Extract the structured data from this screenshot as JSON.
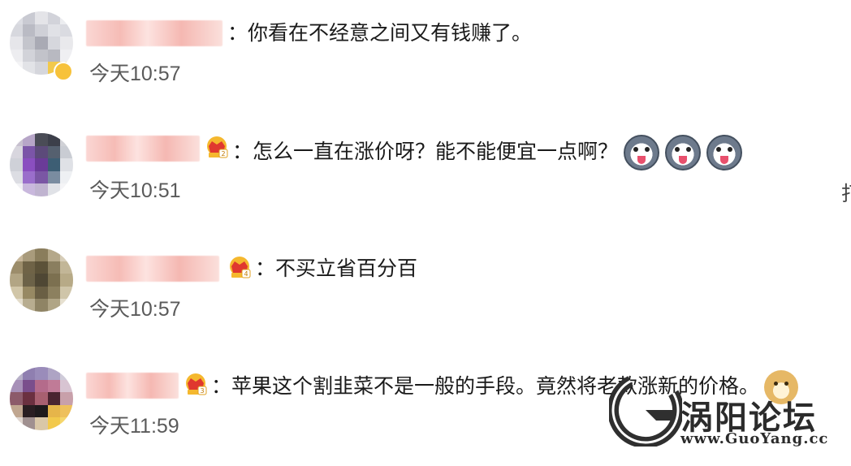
{
  "comments": [
    {
      "separator": "：",
      "text": "你看在不经意之间又有钱赚了。",
      "time": "今天10:57",
      "crown_level": null
    },
    {
      "separator": "：",
      "text": "怎么一直在涨价呀？能不能便宜一点啊？",
      "time": "今天10:51",
      "crown_level": "2"
    },
    {
      "separator": "：",
      "text": "不买立省百分百",
      "time": "今天10:57",
      "crown_level": "4"
    },
    {
      "separator": "：",
      "text": "苹果这个割韭菜不是一般的手段。竟然将老款涨新的价格。",
      "time": "今天11:59",
      "crown_level": "3"
    }
  ],
  "edge_char": "打",
  "watermark": {
    "title": "涡阳论坛",
    "url": "www.GuoYang.cc"
  },
  "colors": {
    "crown_gold": "#f5b82e",
    "crown_red": "#e0382f",
    "time_gray": "#5a5a5a"
  }
}
